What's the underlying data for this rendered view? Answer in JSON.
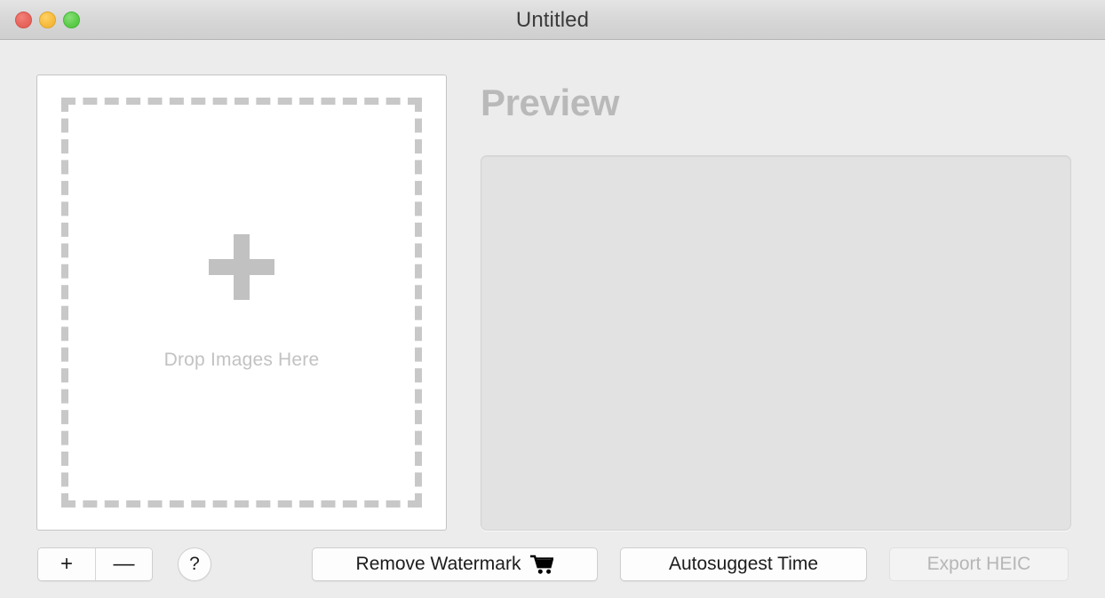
{
  "window": {
    "title": "Untitled",
    "traffic_lights": [
      {
        "name": "close",
        "color": "#ea6a62"
      },
      {
        "name": "minimize",
        "color": "#f7bc3f"
      },
      {
        "name": "zoom",
        "color": "#5fcd4c"
      }
    ],
    "background_color": "#ececec"
  },
  "dropzone": {
    "plus_icon": "plus-icon",
    "label": "Drop Images Here",
    "border_color": "#c8c8c8",
    "background": "#ffffff"
  },
  "preview": {
    "heading": "Preview",
    "heading_color": "#b9b9b9",
    "panel_color": "#e2e2e2"
  },
  "toolbar": {
    "segmented": {
      "add_label": "+",
      "remove_label": "—",
      "add_icon": "plus-icon",
      "remove_icon": "minus-icon"
    },
    "help_label": "?",
    "help_icon": "question-mark-icon",
    "remove_watermark_label": "Remove Watermark",
    "cart_icon": "shopping-cart-icon",
    "autosuggest_label": "Autosuggest Time",
    "export_label": "Export HEIC",
    "export_disabled": true
  }
}
